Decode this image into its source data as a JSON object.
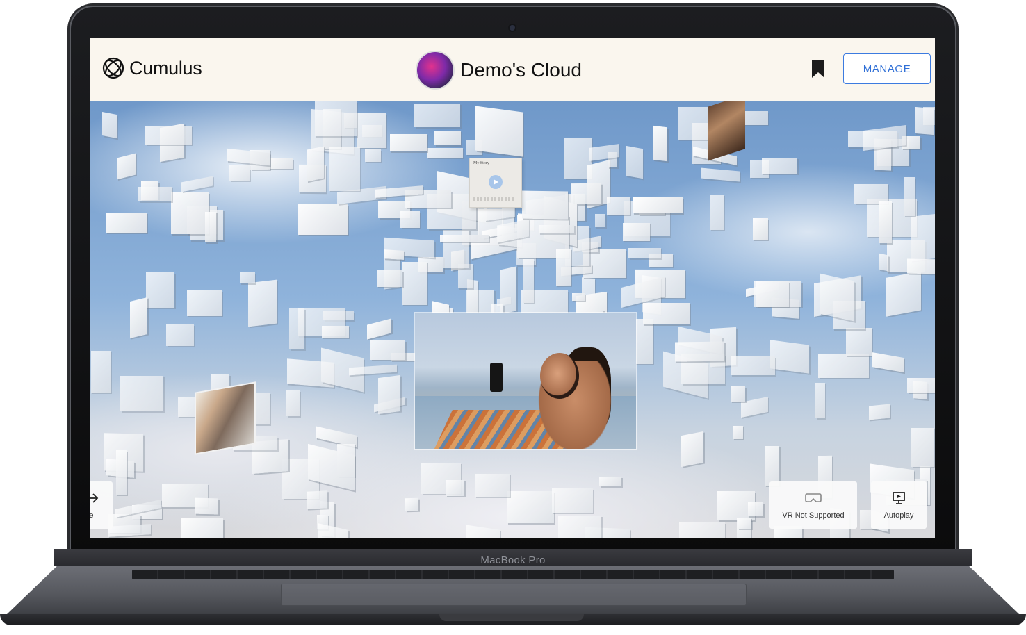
{
  "header": {
    "brand_name": "Cumulus",
    "cloud_title": "Demo's Cloud",
    "manage_label": "MANAGE"
  },
  "scene": {
    "story_card_title": "My Story"
  },
  "controls": {
    "rotate_label": "otate",
    "vr_label": "VR Not Supported",
    "autoplay_label": "Autoplay"
  },
  "device": {
    "model_label": "MacBook Pro"
  },
  "icons": [
    "cumulus-logo-icon",
    "avatar",
    "bookmark-icon",
    "play-icon",
    "arrow-right-icon",
    "vr-headset-icon",
    "autoplay-screen-icon"
  ],
  "colors": {
    "accent": "#2f6fd6",
    "header_bg": "#faf6ee"
  }
}
